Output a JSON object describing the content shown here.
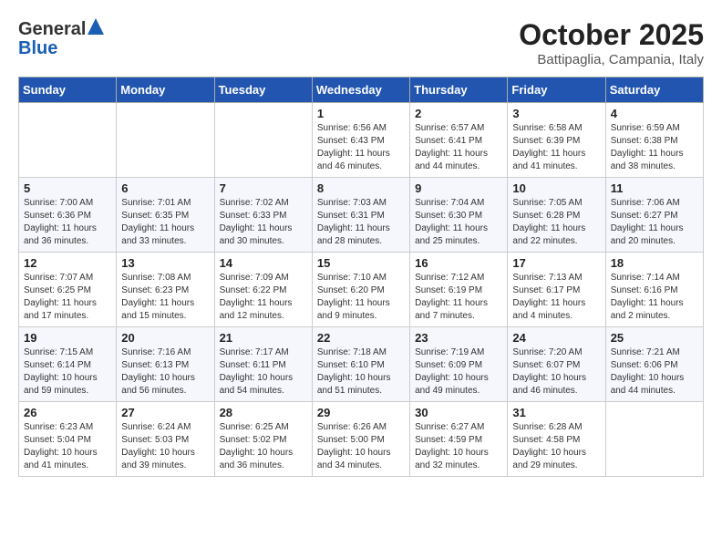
{
  "logo": {
    "general": "General",
    "blue": "Blue"
  },
  "title": "October 2025",
  "subtitle": "Battipaglia, Campania, Italy",
  "days_of_week": [
    "Sunday",
    "Monday",
    "Tuesday",
    "Wednesday",
    "Thursday",
    "Friday",
    "Saturday"
  ],
  "weeks": [
    [
      {
        "day": "",
        "info": ""
      },
      {
        "day": "",
        "info": ""
      },
      {
        "day": "",
        "info": ""
      },
      {
        "day": "1",
        "info": "Sunrise: 6:56 AM\nSunset: 6:43 PM\nDaylight: 11 hours and 46 minutes."
      },
      {
        "day": "2",
        "info": "Sunrise: 6:57 AM\nSunset: 6:41 PM\nDaylight: 11 hours and 44 minutes."
      },
      {
        "day": "3",
        "info": "Sunrise: 6:58 AM\nSunset: 6:39 PM\nDaylight: 11 hours and 41 minutes."
      },
      {
        "day": "4",
        "info": "Sunrise: 6:59 AM\nSunset: 6:38 PM\nDaylight: 11 hours and 38 minutes."
      }
    ],
    [
      {
        "day": "5",
        "info": "Sunrise: 7:00 AM\nSunset: 6:36 PM\nDaylight: 11 hours and 36 minutes."
      },
      {
        "day": "6",
        "info": "Sunrise: 7:01 AM\nSunset: 6:35 PM\nDaylight: 11 hours and 33 minutes."
      },
      {
        "day": "7",
        "info": "Sunrise: 7:02 AM\nSunset: 6:33 PM\nDaylight: 11 hours and 30 minutes."
      },
      {
        "day": "8",
        "info": "Sunrise: 7:03 AM\nSunset: 6:31 PM\nDaylight: 11 hours and 28 minutes."
      },
      {
        "day": "9",
        "info": "Sunrise: 7:04 AM\nSunset: 6:30 PM\nDaylight: 11 hours and 25 minutes."
      },
      {
        "day": "10",
        "info": "Sunrise: 7:05 AM\nSunset: 6:28 PM\nDaylight: 11 hours and 22 minutes."
      },
      {
        "day": "11",
        "info": "Sunrise: 7:06 AM\nSunset: 6:27 PM\nDaylight: 11 hours and 20 minutes."
      }
    ],
    [
      {
        "day": "12",
        "info": "Sunrise: 7:07 AM\nSunset: 6:25 PM\nDaylight: 11 hours and 17 minutes."
      },
      {
        "day": "13",
        "info": "Sunrise: 7:08 AM\nSunset: 6:23 PM\nDaylight: 11 hours and 15 minutes."
      },
      {
        "day": "14",
        "info": "Sunrise: 7:09 AM\nSunset: 6:22 PM\nDaylight: 11 hours and 12 minutes."
      },
      {
        "day": "15",
        "info": "Sunrise: 7:10 AM\nSunset: 6:20 PM\nDaylight: 11 hours and 9 minutes."
      },
      {
        "day": "16",
        "info": "Sunrise: 7:12 AM\nSunset: 6:19 PM\nDaylight: 11 hours and 7 minutes."
      },
      {
        "day": "17",
        "info": "Sunrise: 7:13 AM\nSunset: 6:17 PM\nDaylight: 11 hours and 4 minutes."
      },
      {
        "day": "18",
        "info": "Sunrise: 7:14 AM\nSunset: 6:16 PM\nDaylight: 11 hours and 2 minutes."
      }
    ],
    [
      {
        "day": "19",
        "info": "Sunrise: 7:15 AM\nSunset: 6:14 PM\nDaylight: 10 hours and 59 minutes."
      },
      {
        "day": "20",
        "info": "Sunrise: 7:16 AM\nSunset: 6:13 PM\nDaylight: 10 hours and 56 minutes."
      },
      {
        "day": "21",
        "info": "Sunrise: 7:17 AM\nSunset: 6:11 PM\nDaylight: 10 hours and 54 minutes."
      },
      {
        "day": "22",
        "info": "Sunrise: 7:18 AM\nSunset: 6:10 PM\nDaylight: 10 hours and 51 minutes."
      },
      {
        "day": "23",
        "info": "Sunrise: 7:19 AM\nSunset: 6:09 PM\nDaylight: 10 hours and 49 minutes."
      },
      {
        "day": "24",
        "info": "Sunrise: 7:20 AM\nSunset: 6:07 PM\nDaylight: 10 hours and 46 minutes."
      },
      {
        "day": "25",
        "info": "Sunrise: 7:21 AM\nSunset: 6:06 PM\nDaylight: 10 hours and 44 minutes."
      }
    ],
    [
      {
        "day": "26",
        "info": "Sunrise: 6:23 AM\nSunset: 5:04 PM\nDaylight: 10 hours and 41 minutes."
      },
      {
        "day": "27",
        "info": "Sunrise: 6:24 AM\nSunset: 5:03 PM\nDaylight: 10 hours and 39 minutes."
      },
      {
        "day": "28",
        "info": "Sunrise: 6:25 AM\nSunset: 5:02 PM\nDaylight: 10 hours and 36 minutes."
      },
      {
        "day": "29",
        "info": "Sunrise: 6:26 AM\nSunset: 5:00 PM\nDaylight: 10 hours and 34 minutes."
      },
      {
        "day": "30",
        "info": "Sunrise: 6:27 AM\nSunset: 4:59 PM\nDaylight: 10 hours and 32 minutes."
      },
      {
        "day": "31",
        "info": "Sunrise: 6:28 AM\nSunset: 4:58 PM\nDaylight: 10 hours and 29 minutes."
      },
      {
        "day": "",
        "info": ""
      }
    ]
  ]
}
